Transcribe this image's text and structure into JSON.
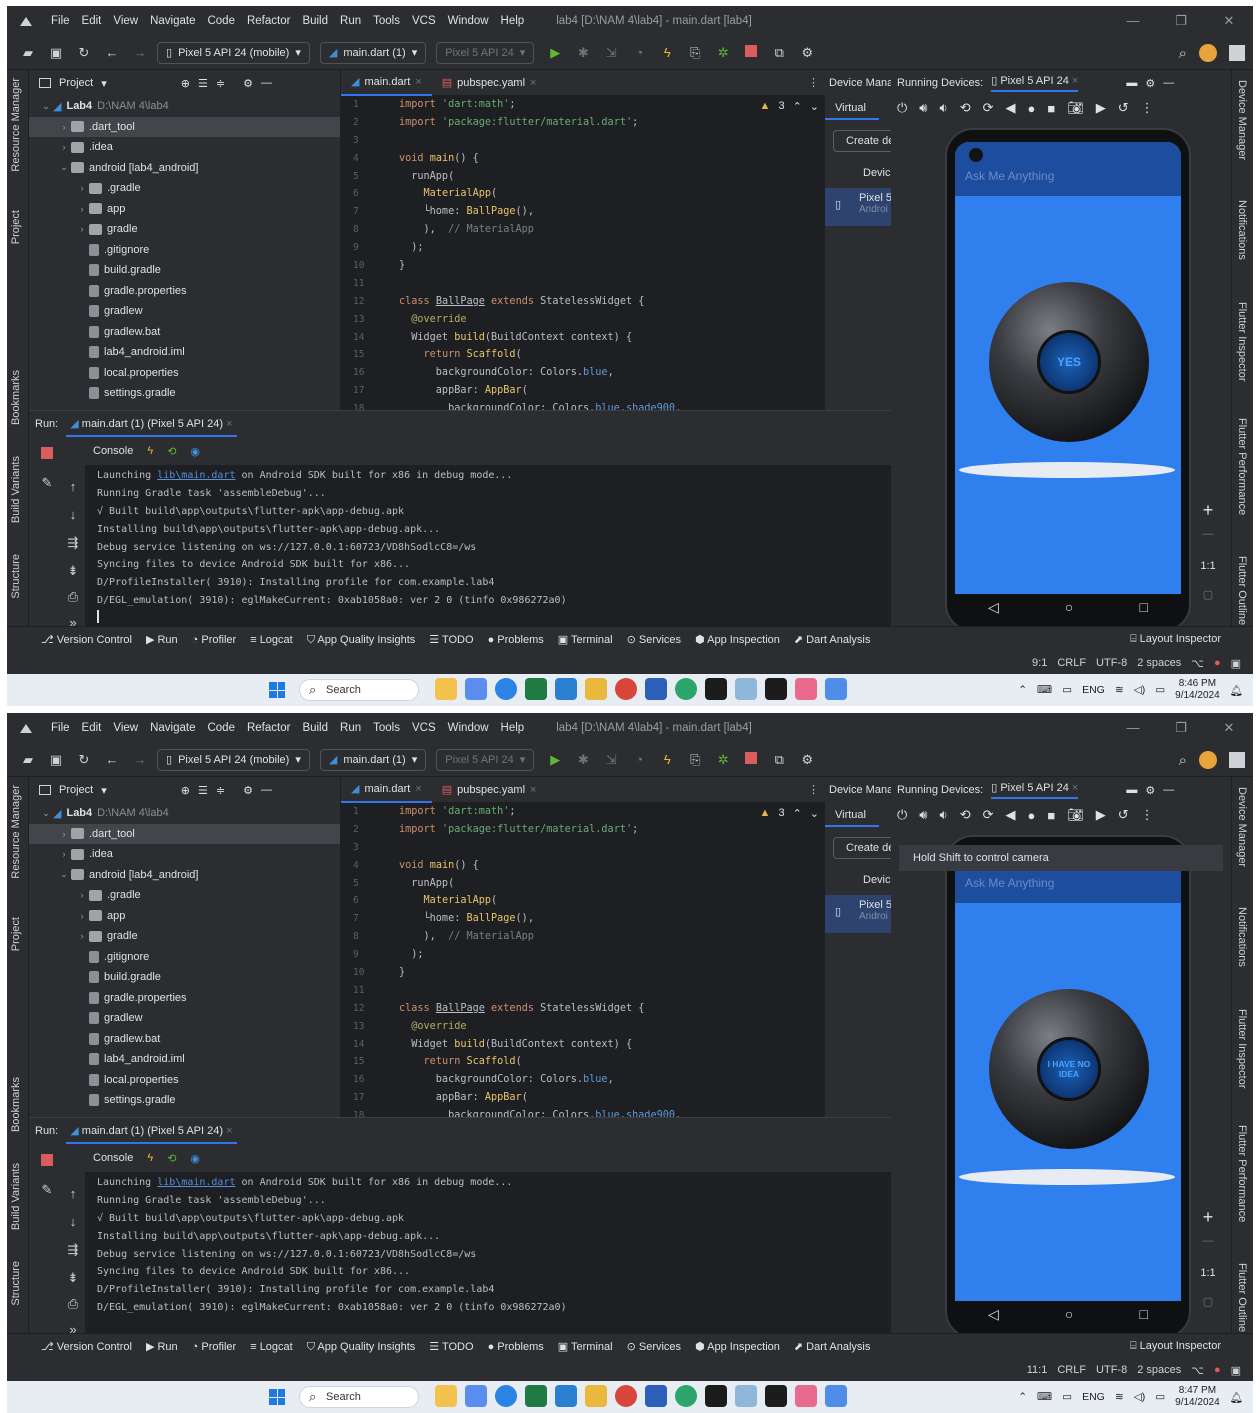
{
  "menu": [
    "File",
    "Edit",
    "View",
    "Navigate",
    "Code",
    "Refactor",
    "Build",
    "Run",
    "Tools",
    "VCS",
    "Window",
    "Help"
  ],
  "window_title": "lab4 [D:\\NAM 4\\lab4] - main.dart [lab4]",
  "toolbar": {
    "device_select": "Pixel 5 API 24 (mobile)",
    "run_config": "main.dart (1)",
    "device_dim": "Pixel 5 API 24"
  },
  "project": {
    "header": "Project",
    "root_name": "Lab4",
    "root_path": "D:\\NAM 4\\lab4",
    "items": [
      {
        "name": ".dart_tool",
        "indent": 1,
        "arrow": "›",
        "icon": "folder"
      },
      {
        "name": ".idea",
        "indent": 1,
        "arrow": "›",
        "icon": "folder"
      },
      {
        "name": "android [lab4_android]",
        "indent": 1,
        "arrow": "⌄",
        "icon": "folder"
      },
      {
        "name": ".gradle",
        "indent": 2,
        "arrow": "›",
        "icon": "folder"
      },
      {
        "name": "app",
        "indent": 2,
        "arrow": "›",
        "icon": "folder"
      },
      {
        "name": "gradle",
        "indent": 2,
        "arrow": "›",
        "icon": "folder"
      },
      {
        "name": ".gitignore",
        "indent": 2,
        "arrow": "",
        "icon": "file"
      },
      {
        "name": "build.gradle",
        "indent": 2,
        "arrow": "",
        "icon": "file"
      },
      {
        "name": "gradle.properties",
        "indent": 2,
        "arrow": "",
        "icon": "file"
      },
      {
        "name": "gradlew",
        "indent": 2,
        "arrow": "",
        "icon": "file"
      },
      {
        "name": "gradlew.bat",
        "indent": 2,
        "arrow": "",
        "icon": "file"
      },
      {
        "name": "lab4_android.iml",
        "indent": 2,
        "arrow": "",
        "icon": "file"
      },
      {
        "name": "local.properties",
        "indent": 2,
        "arrow": "",
        "icon": "file"
      },
      {
        "name": "settings.gradle",
        "indent": 2,
        "arrow": "",
        "icon": "file"
      }
    ]
  },
  "editor": {
    "tabs": [
      "main.dart",
      "pubspec.yaml"
    ],
    "warnings": "3",
    "lines": [
      "1",
      "2",
      "3",
      "4",
      "5",
      "6",
      "7",
      "8",
      "9",
      "10",
      "11",
      "12",
      "13",
      "14",
      "15",
      "16",
      "17",
      "18"
    ]
  },
  "device_manager": {
    "header": "Device Mana",
    "tab": "Virtual",
    "create_btn": "Create de",
    "col_device": "Devic",
    "device_name": "Pixel 5",
    "device_sub": "Androi"
  },
  "emulator": {
    "header": "Running Devices:",
    "device_tab": "Pixel 5 API 24",
    "appbar_title": "Ask Me Anything",
    "zoom_ratio": "1:1",
    "tooltip": "Hold Shift to control camera"
  },
  "run": {
    "label": "Run:",
    "tab": "main.dart (1) (Pixel 5 API 24)",
    "console_tab": "Console",
    "console_lines": [
      {
        "pre": "Launching ",
        "link": "lib\\main.dart",
        "post": " on Android SDK built for x86 in debug mode..."
      },
      {
        "pre": "Running Gradle task 'assembleDebug'...",
        "link": "",
        "post": ""
      },
      {
        "pre": "√ Built build\\app\\outputs\\flutter-apk\\app-debug.apk",
        "link": "",
        "post": ""
      },
      {
        "pre": "Installing build\\app\\outputs\\flutter-apk\\app-debug.apk...",
        "link": "",
        "post": ""
      },
      {
        "pre": "Debug service listening on ws://127.0.0.1:60723/VD8hSodlcC8=/ws",
        "link": "",
        "post": ""
      },
      {
        "pre": "Syncing files to device Android SDK built for x86...",
        "link": "",
        "post": ""
      },
      {
        "pre": "D/ProfileInstaller( 3910): Installing profile for com.example.lab4",
        "link": "",
        "post": ""
      },
      {
        "pre": "D/EGL_emulation( 3910): eglMakeCurrent: 0xab1058a0: ver 2 0 (tinfo 0x986272a0)",
        "link": "",
        "post": ""
      }
    ]
  },
  "bottom_tabs": [
    "Version Control",
    "Run",
    "Profiler",
    "Logcat",
    "App Quality Insights",
    "TODO",
    "Problems",
    "Terminal",
    "Services",
    "App Inspection",
    "Dart Analysis"
  ],
  "layout_inspector": "Layout Inspector",
  "left_strip": [
    "Resource Manager",
    "Project",
    "Bookmarks",
    "Build Variants",
    "Structure"
  ],
  "right_strip": [
    "Device Manager",
    "Notifications",
    "Flutter Inspector",
    "Flutter Performance",
    "Flutter Outline"
  ],
  "status": {
    "encoding": "CRLF",
    "charset": "UTF-8",
    "indent": "2 spaces"
  },
  "taskbar": {
    "search": "Search",
    "lang": "ENG"
  },
  "shots": [
    {
      "ball_text": "YES",
      "cursor_pos": "9:1",
      "time": "8:46 PM",
      "date": "9/14/2024",
      "show_tooltip": false
    },
    {
      "ball_text": "I HAVE NO IDEA",
      "cursor_pos": "11:1",
      "time": "8:47 PM",
      "date": "9/14/2024",
      "show_tooltip": true
    }
  ],
  "colors": {
    "accent": "#3574f0",
    "phone_screen": "#2f7fef",
    "appbar": "#1d4d9e",
    "run_green": "#5fb832",
    "stop_red": "#db5c5c"
  }
}
